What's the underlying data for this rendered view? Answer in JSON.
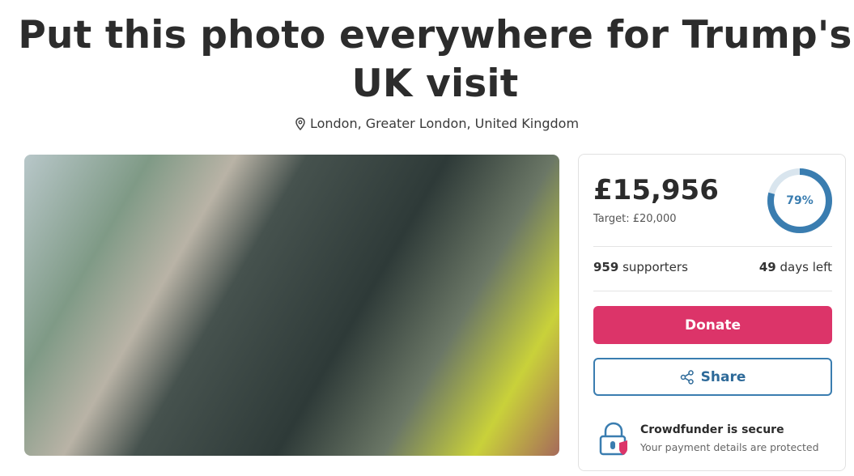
{
  "page": {
    "title": "Put this photo everywhere for Trump's UK visit",
    "location": "London, Greater London, United Kingdom"
  },
  "photo": {
    "label": ""
  },
  "funding": {
    "raised": "£15,956",
    "target": "Target: £20,000",
    "percent_label": "79%",
    "percent_value": 0.79,
    "supporters_count": "959",
    "supporters_label": "supporters",
    "days_count": "49",
    "days_label": "days left"
  },
  "actions": {
    "donate_label": "Donate",
    "share_label": "Share"
  },
  "security": {
    "title": "Crowdfunder is secure",
    "subtitle": "Your payment details are protected"
  },
  "colors": {
    "donate": "#dc3469",
    "share": "#3a7db0",
    "ring_track": "#d9e5ee",
    "ring_progress": "#3a7db0"
  }
}
